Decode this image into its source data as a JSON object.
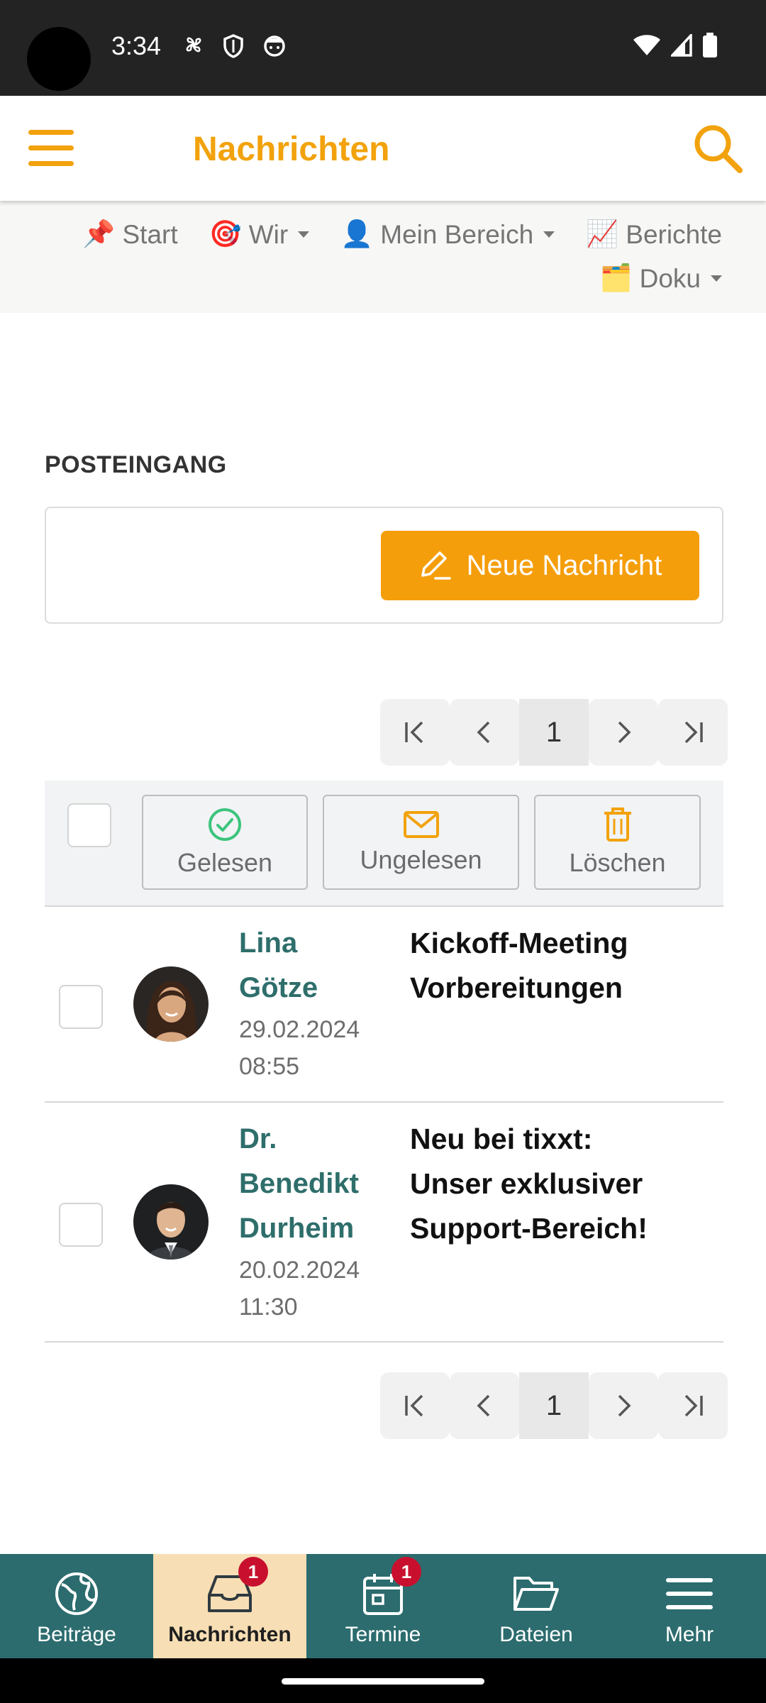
{
  "status_bar": {
    "time": "3:34"
  },
  "app_bar": {
    "title": "Nachrichten"
  },
  "top_nav": {
    "items": [
      {
        "emoji": "📌",
        "label": "Start"
      },
      {
        "emoji": "🎯",
        "label": "Wir"
      },
      {
        "emoji": "👤",
        "label": "Mein Bereich"
      },
      {
        "emoji": "📈",
        "label": "Berichte"
      },
      {
        "emoji": "🗂️",
        "label": "Doku"
      }
    ]
  },
  "section": {
    "title": "POSTEINGANG"
  },
  "compose": {
    "new_message_label": "Neue Nachricht"
  },
  "pagination": {
    "current_page": "1"
  },
  "toolbar": {
    "read_label": "Gelesen",
    "unread_label": "Ungelesen",
    "delete_label": "Löschen"
  },
  "messages": [
    {
      "sender_line1": "Lina",
      "sender_line2": "Götze",
      "sender_line3": "",
      "date": "29.02.2024",
      "time": "08:55",
      "subject_line1": "Kickoff-Meeting",
      "subject_line2": "Vorbereitungen",
      "subject_line3": ""
    },
    {
      "sender_line1": "Dr.",
      "sender_line2": "Benedikt",
      "sender_line3": "Durheim",
      "date": "20.02.2024",
      "time": "11:30",
      "subject_line1": "Neu bei tixxt:",
      "subject_line2": "Unser exklusiver",
      "subject_line3": "Support-Bereich!"
    }
  ],
  "bottom_nav": {
    "items": [
      {
        "label": "Beiträge",
        "icon": "globe-icon",
        "badge": ""
      },
      {
        "label": "Nachrichten",
        "icon": "inbox-icon",
        "badge": "1"
      },
      {
        "label": "Termine",
        "icon": "calendar-icon",
        "badge": "1"
      },
      {
        "label": "Dateien",
        "icon": "folder-icon",
        "badge": ""
      },
      {
        "label": "Mehr",
        "icon": "menu-icon",
        "badge": ""
      }
    ]
  },
  "colors": {
    "accent": "#f2a20c",
    "teal": "#2c6c6e",
    "active_tab": "#f7deb4",
    "badge": "#c8102e"
  }
}
